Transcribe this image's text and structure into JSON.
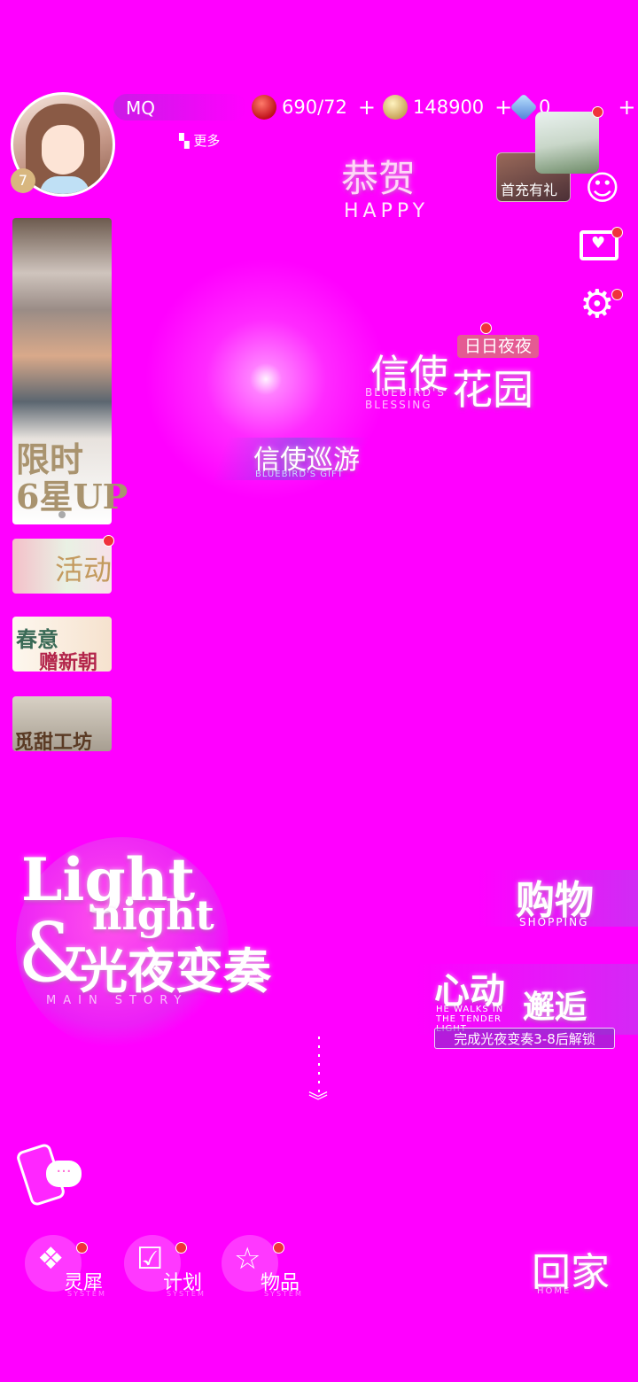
{
  "player": {
    "name": "MQ",
    "level": "7",
    "more_label": "更多"
  },
  "resources": {
    "stamina": "690/72",
    "coins": "148900",
    "diamonds": "0",
    "plus": "+"
  },
  "right_panel": {
    "first_recharge": "首充有礼"
  },
  "festival": {
    "congrats_cn": "恭贺",
    "congrats_en": "HAPPY"
  },
  "messenger_garden": {
    "badge": "日日夜夜",
    "title_1": "信使",
    "title_2": "花园",
    "subtitle_en": "BLUEBIRD'S BLESSING"
  },
  "messenger_tour": {
    "title": "信使巡游",
    "subtitle_en": "BLUEBIRD'S GIFT"
  },
  "left_banners": {
    "limited": "限时\n6星UP",
    "activity": "活动",
    "spring_1": "春意",
    "spring_2": "赠新朝",
    "workshop": "觅甜工坊"
  },
  "main_story": {
    "light": "Light",
    "night": "night",
    "amp": "&",
    "title_cn": "光夜变奏",
    "tag": "MAIN STORY"
  },
  "shopping": {
    "title_cn": "购物",
    "title_en": "SHOPPING"
  },
  "encounter": {
    "title_1": "心动",
    "title_2": "邂逅",
    "subtitle_en": "HE WALKS IN THE TENDER LIGHT",
    "unlock_tip": "完成光夜变奏3-8后解锁"
  },
  "dock": {
    "lingwu": "灵犀",
    "plan": "计划",
    "items": "物品",
    "system": "SYSTEM"
  },
  "home": {
    "label": "回家",
    "label_en": "HOME"
  },
  "colors": {
    "background": "#ff00ff",
    "reddot": "#f0323c",
    "badge": "#e45b93"
  },
  "icons": [
    "apple-icon",
    "coin-icon",
    "diamond-icon",
    "grid-icon",
    "hint-icon",
    "mailbox-icon",
    "gear-icon",
    "chat-icon",
    "phone-icon",
    "wings-icon",
    "calendar-icon",
    "star-icon",
    "chevron-down-icon"
  ]
}
